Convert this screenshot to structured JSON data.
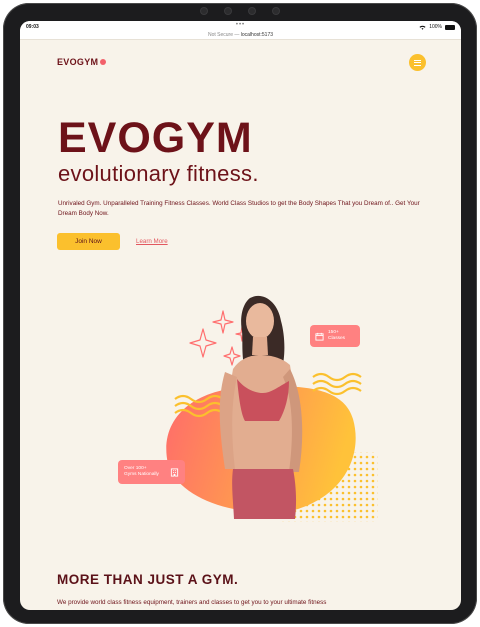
{
  "statusbar": {
    "time": "09:03",
    "dots": "•••",
    "battery": "100%"
  },
  "urlbar": {
    "security": "Not Secure —",
    "host": "localhost:5173"
  },
  "nav": {
    "logo": "EVOGYM"
  },
  "hero": {
    "title": "EVOGYM",
    "subtitle": "evolutionary fitness.",
    "text": "Unrivaled Gym. Unparalleled Training Fitness Classes. World Class Studios to get the Body Shapes That you Dream of.. Get Your Dream Body Now.",
    "join_label": "Join Now",
    "learn_label": "Learn More"
  },
  "badges": {
    "classes_line1": "150+",
    "classes_line2": "Classes",
    "studios_line1": "Over 100+",
    "studios_line2": "Gyms Nationally"
  },
  "section": {
    "title": "MORE THAN JUST A GYM.",
    "text": "We provide world class fitness equipment, trainers and classes to get you to your ultimate fitness"
  },
  "colors": {
    "accent": "#fbc02d",
    "brand": "#6d1219",
    "coral": "#ff8181",
    "background": "#f8f3ea"
  }
}
